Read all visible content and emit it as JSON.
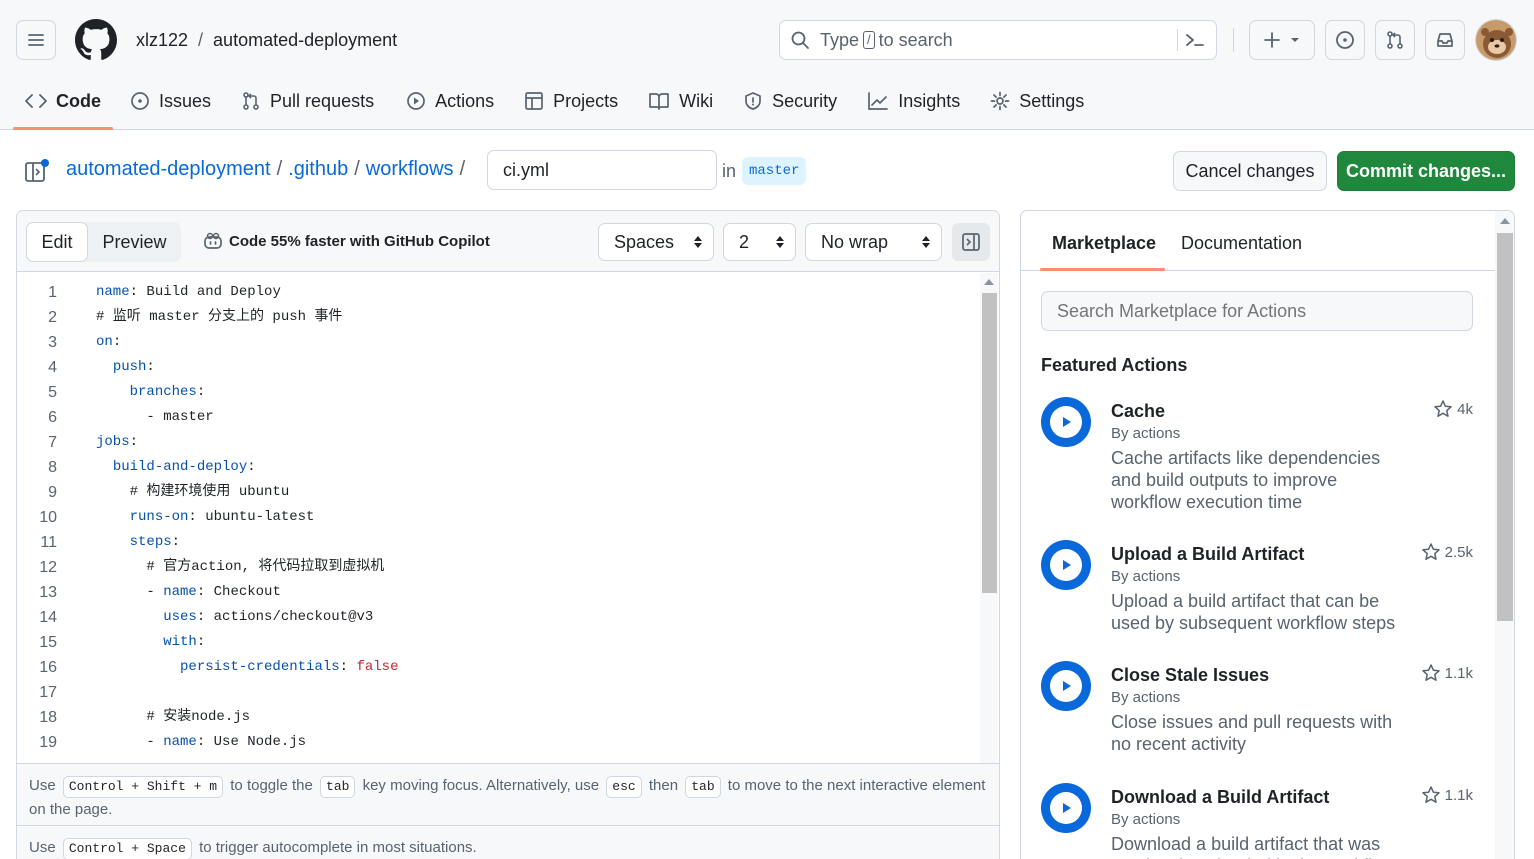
{
  "header": {
    "owner": "xlz122",
    "separator": "/",
    "repo": "automated-deployment",
    "search": {
      "prefix": "Type",
      "key": "/",
      "suffix": "to search"
    }
  },
  "nav": [
    {
      "label": "Code",
      "icon": "code-icon"
    },
    {
      "label": "Issues",
      "icon": "issue-opened-icon"
    },
    {
      "label": "Pull requests",
      "icon": "git-pull-request-icon"
    },
    {
      "label": "Actions",
      "icon": "play-icon"
    },
    {
      "label": "Projects",
      "icon": "table-icon"
    },
    {
      "label": "Wiki",
      "icon": "book-icon"
    },
    {
      "label": "Security",
      "icon": "shield-icon"
    },
    {
      "label": "Insights",
      "icon": "graph-icon"
    },
    {
      "label": "Settings",
      "icon": "gear-icon"
    }
  ],
  "path": {
    "repo": "automated-deployment",
    "dir1": ".github",
    "dir2": "workflows",
    "sep": "/",
    "filename": "ci.yml",
    "in_label": "in",
    "branch": "master"
  },
  "actions_bar": {
    "cancel": "Cancel changes",
    "commit": "Commit changes..."
  },
  "editor": {
    "tabs": {
      "edit": "Edit",
      "preview": "Preview"
    },
    "copilot": "Code 55% faster with GitHub Copilot",
    "indent_mode": "Spaces",
    "indent_size": "2",
    "wrap_mode": "No wrap",
    "lines": [
      {
        "n": "1",
        "indent": "",
        "key": "name",
        "colon": ": ",
        "val": "Build and Deploy",
        "bool": ""
      },
      {
        "n": "2",
        "indent": "",
        "key": "",
        "colon": "",
        "val": "# 监听 master 分支上的 push 事件",
        "bool": ""
      },
      {
        "n": "3",
        "indent": "",
        "key": "on",
        "colon": ":",
        "val": "",
        "bool": ""
      },
      {
        "n": "4",
        "indent": "  ",
        "key": "push",
        "colon": ":",
        "val": "",
        "bool": ""
      },
      {
        "n": "5",
        "indent": "    ",
        "key": "branches",
        "colon": ":",
        "val": "",
        "bool": ""
      },
      {
        "n": "6",
        "indent": "      ",
        "key": "",
        "colon": "",
        "val": "- master",
        "bool": ""
      },
      {
        "n": "7",
        "indent": "",
        "key": "jobs",
        "colon": ":",
        "val": "",
        "bool": ""
      },
      {
        "n": "8",
        "indent": "  ",
        "key": "build-and-deploy",
        "colon": ":",
        "val": "",
        "bool": ""
      },
      {
        "n": "9",
        "indent": "    ",
        "key": "",
        "colon": "",
        "val": "# 构建环境使用 ubuntu",
        "bool": ""
      },
      {
        "n": "10",
        "indent": "    ",
        "key": "runs-on",
        "colon": ": ",
        "val": "ubuntu-latest",
        "bool": ""
      },
      {
        "n": "11",
        "indent": "    ",
        "key": "steps",
        "colon": ":",
        "val": "",
        "bool": ""
      },
      {
        "n": "12",
        "indent": "      ",
        "key": "",
        "colon": "",
        "val": "# 官方action, 将代码拉取到虚拟机",
        "bool": ""
      },
      {
        "n": "13",
        "indent": "      - ",
        "key": "name",
        "colon": ": ",
        "val": "Checkout",
        "bool": ""
      },
      {
        "n": "14",
        "indent": "        ",
        "key": "uses",
        "colon": ": ",
        "val": "actions/checkout@v3",
        "bool": ""
      },
      {
        "n": "15",
        "indent": "        ",
        "key": "with",
        "colon": ":",
        "val": "",
        "bool": ""
      },
      {
        "n": "16",
        "indent": "          ",
        "key": "persist-credentials",
        "colon": ": ",
        "val": "",
        "bool": "false"
      },
      {
        "n": "17",
        "indent": "",
        "key": "",
        "colon": "",
        "val": "",
        "bool": ""
      },
      {
        "n": "18",
        "indent": "      ",
        "key": "",
        "colon": "",
        "val": "# 安装node.js",
        "bool": ""
      },
      {
        "n": "19",
        "indent": "      - ",
        "key": "name",
        "colon": ": ",
        "val": "Use Node.js",
        "bool": ""
      }
    ],
    "hint1": {
      "use": "Use",
      "k1": "Control + Shift + m",
      "t1": "to toggle the",
      "k2": "tab",
      "t2": "key moving focus. Alternatively, use",
      "k3": "esc",
      "t3": "then",
      "k4": "tab",
      "t4": "to move to the next interactive element on the page."
    },
    "hint2": {
      "use": "Use",
      "k1": "Control + Space",
      "t1": "to trigger autocomplete in most situations."
    }
  },
  "marketplace": {
    "tabs": {
      "marketplace": "Marketplace",
      "documentation": "Documentation"
    },
    "search_placeholder": "Search Marketplace for Actions",
    "heading": "Featured Actions",
    "items": [
      {
        "name": "Cache",
        "by": "By actions",
        "desc": "Cache artifacts like dependencies and build outputs to improve workflow execution time",
        "stars": "4k"
      },
      {
        "name": "Upload a Build Artifact",
        "by": "By actions",
        "desc": "Upload a build artifact that can be used by subsequent workflow steps",
        "stars": "2.5k"
      },
      {
        "name": "Close Stale Issues",
        "by": "By actions",
        "desc": "Close issues and pull requests with no recent activity",
        "stars": "1.1k"
      },
      {
        "name": "Download a Build Artifact",
        "by": "By actions",
        "desc": "Download a build artifact that was previously uploaded in the workflow",
        "stars": "1.1k"
      }
    ]
  },
  "colors": {
    "accent_green": "#1f883d",
    "link_blue": "#0969da",
    "tab_underline": "#fd8c73",
    "yaml_key": "#0550ae",
    "yaml_bool": "#cf222e"
  }
}
